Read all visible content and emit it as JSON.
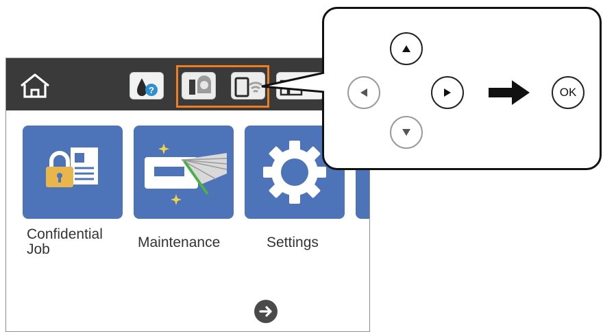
{
  "colors": {
    "status_bar": "#3a3a3a",
    "tile_blue": "#4d74b8",
    "highlight_orange": "#ef7d22",
    "callout_border": "#111111"
  },
  "status_bar": {
    "icons": [
      "home-icon",
      "ink-drop-help-icon",
      "network-wired-icon",
      "wifi-direct-icon",
      "fax-icon"
    ]
  },
  "menu": {
    "tiles": [
      {
        "icon": "lock-document-icon",
        "label_line1": "Confidential",
        "label_line2": "Job"
      },
      {
        "icon": "maintenance-icon",
        "label_line1": "Maintenance",
        "label_line2": ""
      },
      {
        "icon": "gear-icon",
        "label_line1": "Settings",
        "label_line2": ""
      }
    ],
    "next_icon": "arrow-right-circle-icon"
  },
  "callout": {
    "buttons": [
      "up-icon",
      "left-icon",
      "right-icon",
      "down-icon"
    ],
    "ok_label": "OK",
    "arrow_icon": "arrow-right-icon"
  }
}
